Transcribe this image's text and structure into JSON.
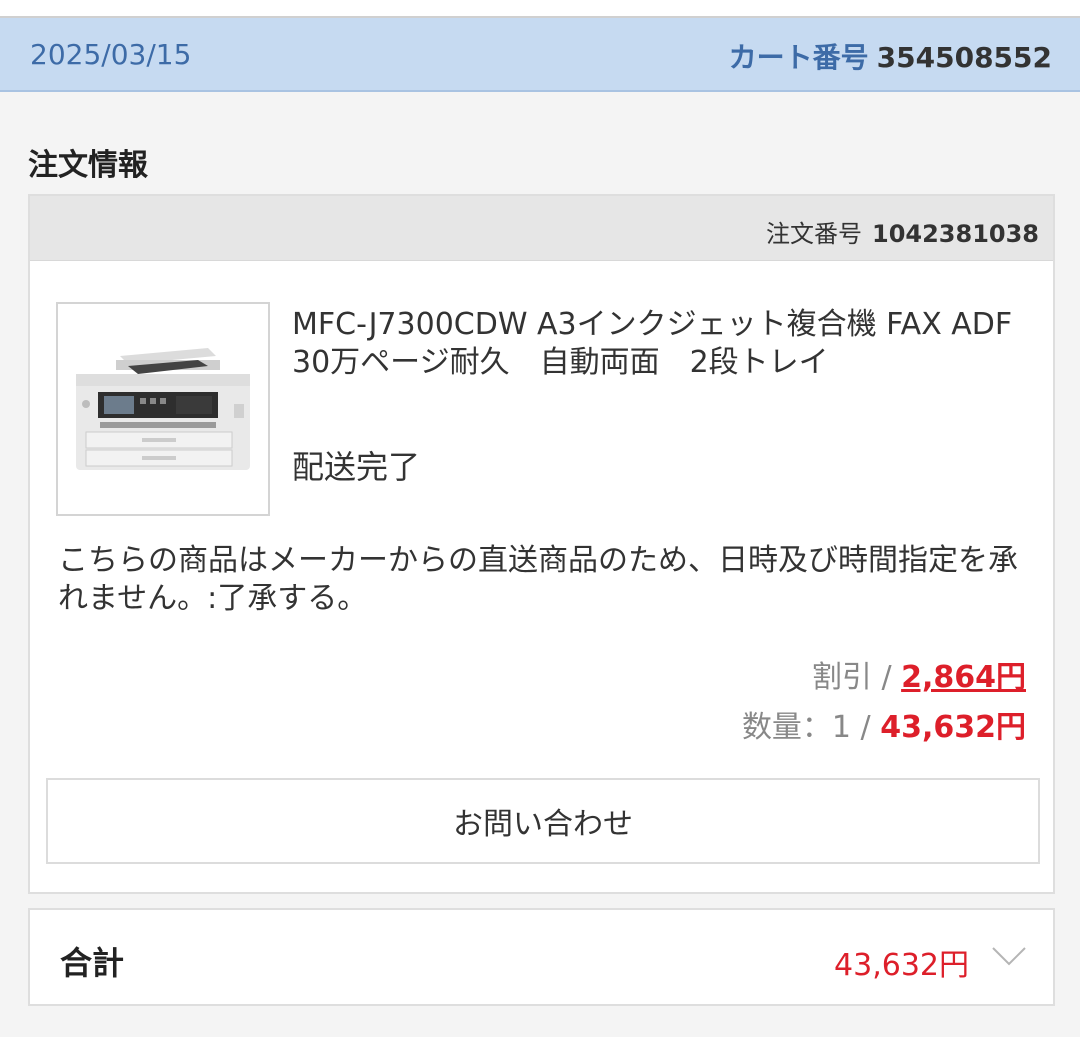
{
  "cart": {
    "date": "2025/03/15",
    "number_label": "カート番号",
    "number": "354508552"
  },
  "section_title": "注文情報",
  "order": {
    "number_label": "注文番号",
    "number": "1042381038",
    "product_name": "MFC-J7300CDW A3インクジェット複合機 FAX ADF　30万ページ耐久　自動両面　2段トレイ",
    "status": "配送完了",
    "note": "こちらの商品はメーカーからの直送商品のため、日時及び時間指定を承れません。:了承する。",
    "discount_label": "割引 / ",
    "discount_amount": "2,864円",
    "quantity_label": "数量：1 / ",
    "quantity_amount": "43,632円",
    "contact_button": "お問い合わせ"
  },
  "total": {
    "label": "合計",
    "amount": "43,632円"
  },
  "colors": {
    "header_bg": "#c6daf1",
    "accent_blue": "#3d6ba7",
    "price_red": "#dd1f2a"
  },
  "icons": {
    "product_image": "printer-image",
    "expand": "chevron-down-icon"
  }
}
